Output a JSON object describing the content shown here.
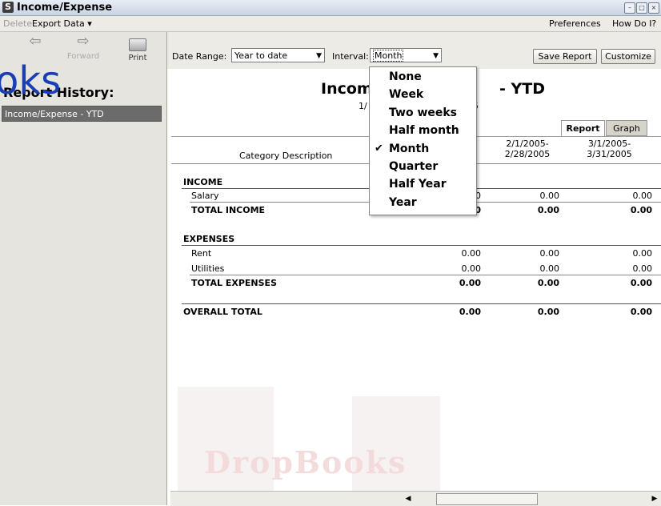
{
  "window": {
    "title": "Income/Expense",
    "app_icon": "S"
  },
  "menubar": {
    "delete": "Delete",
    "export": "Export Data",
    "preferences": "Preferences",
    "how_do_i": "How Do I?"
  },
  "toolbar": {
    "forward": "Forward",
    "print": "Print"
  },
  "sidebar": {
    "heading": "Report History:",
    "items": [
      "Income/Expense - YTD"
    ]
  },
  "overlay_text": "oks",
  "controls": {
    "date_range_label": "Date Range:",
    "date_range_value": "Year to date",
    "interval_label": "Interval:",
    "interval_value": "Month",
    "save_report": "Save Report",
    "customize": "Customize"
  },
  "report": {
    "title_left": "Incom",
    "title_right": "- YTD",
    "date_left": "1/",
    "date_right": "5",
    "tabs": [
      "Report",
      "Graph"
    ],
    "columns": {
      "category": "Category Description",
      "col2_top": "2/1/2005-",
      "col2_bottom": "2/28/2005",
      "col3_top": "3/1/2005-",
      "col3_bottom": "3/31/2005"
    },
    "income": {
      "heading": "INCOME",
      "salary_label": "Salary",
      "salary_values": [
        "0",
        "0.00",
        "0.00"
      ],
      "total_label": "TOTAL INCOME",
      "total_values": [
        "0",
        "0.00",
        "0.00"
      ]
    },
    "expenses": {
      "heading": "EXPENSES",
      "rent_label": "Rent",
      "rent_values": [
        "0.00",
        "0.00",
        "0.00"
      ],
      "utilities_label": "Utilities",
      "utilities_values": [
        "0.00",
        "0.00",
        "0.00"
      ],
      "total_label": "TOTAL EXPENSES",
      "total_values": [
        "0.00",
        "0.00",
        "0.00"
      ]
    },
    "overall": {
      "label": "OVERALL TOTAL",
      "values": [
        "0.00",
        "0.00",
        "0.00"
      ]
    }
  },
  "interval_dropdown": {
    "options": [
      "None",
      "Week",
      "Two weeks",
      "Half month",
      "Month",
      "Quarter",
      "Half Year",
      "Year"
    ],
    "selected": "Month"
  },
  "watermark": "DropBooks"
}
